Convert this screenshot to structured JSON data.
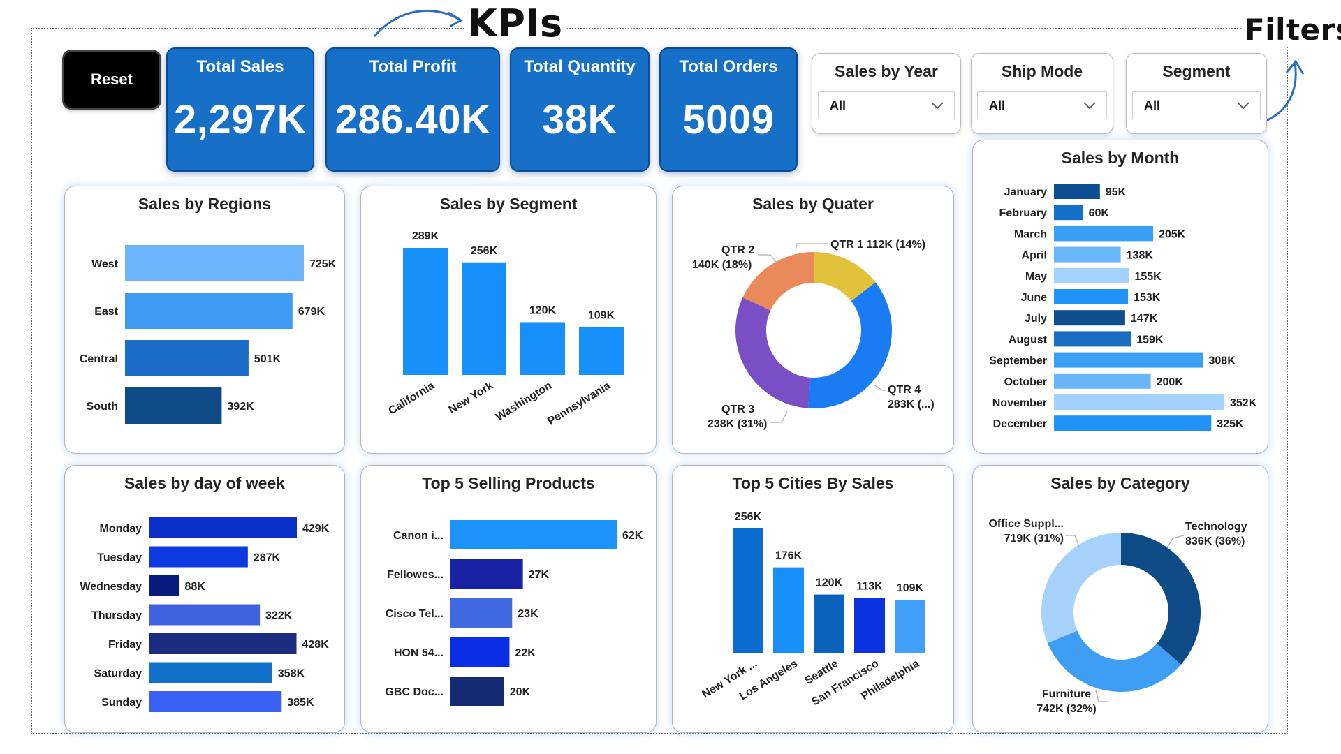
{
  "annotations": {
    "kpis": "KPIs",
    "filters": "Filters"
  },
  "reset_label": "Reset",
  "kpis": [
    {
      "title": "Total Sales",
      "value": "2,297K"
    },
    {
      "title": "Total Profit",
      "value": "286.40K"
    },
    {
      "title": "Total Quantity",
      "value": "38K"
    },
    {
      "title": "Total Orders",
      "value": "5009"
    }
  ],
  "filters": [
    {
      "title": "Sales by Year",
      "value": "All"
    },
    {
      "title": "Ship Mode",
      "value": "All"
    },
    {
      "title": "Segment",
      "value": "All"
    }
  ],
  "colors": {
    "kpi_bg": "#1670c8",
    "filter_border": "#bdbdbd",
    "card_glow": "#5a96e6"
  },
  "icons": [
    "chevron-down-icon",
    "curved-arrow-icon"
  ],
  "charts": {
    "regions": {
      "title": "Sales by Regions",
      "type": "bar-horizontal",
      "categories": [
        "West",
        "East",
        "Central",
        "South"
      ],
      "values": [
        725,
        679,
        501,
        392
      ],
      "labels": [
        "725K",
        "679K",
        "501K",
        "392K"
      ],
      "colors": [
        "#6cb4fb",
        "#3d9bf3",
        "#1a6cc6",
        "#0d4a87"
      ]
    },
    "segment": {
      "title": "Sales by Segment",
      "type": "bar",
      "categories": [
        "California",
        "New York",
        "Washington",
        "Pennsylvania"
      ],
      "values": [
        289,
        256,
        120,
        109
      ],
      "labels": [
        "289K",
        "256K",
        "120K",
        "109K"
      ],
      "color": "#1890fb"
    },
    "quarter": {
      "title": "Sales by Quater",
      "type": "donut",
      "slices": [
        {
          "name": "QTR 1",
          "value": 112,
          "label": "QTR 1 112K (14%)",
          "color": "#e2c13b"
        },
        {
          "name": "QTR 4",
          "value": 283,
          "label_lines": [
            "QTR 4",
            "283K (...)"
          ],
          "color": "#1a7cf2"
        },
        {
          "name": "QTR 3",
          "value": 238,
          "label_lines": [
            "QTR 3",
            "238K (31%)"
          ],
          "color": "#7a4fc6"
        },
        {
          "name": "QTR 2",
          "value": 140,
          "label_lines": [
            "QTR 2",
            "140K (18%)"
          ],
          "color": "#ea8a5b"
        }
      ]
    },
    "month": {
      "title": "Sales by Month",
      "type": "bar-horizontal",
      "categories": [
        "January",
        "February",
        "March",
        "April",
        "May",
        "June",
        "July",
        "August",
        "September",
        "October",
        "November",
        "December"
      ],
      "values": [
        95,
        60,
        205,
        138,
        155,
        153,
        147,
        159,
        308,
        200,
        352,
        325
      ],
      "labels": [
        "95K",
        "60K",
        "205K",
        "138K",
        "155K",
        "153K",
        "147K",
        "159K",
        "308K",
        "200K",
        "352K",
        "325K"
      ],
      "colors": [
        "#0d4f93",
        "#1570c8",
        "#3aa0f6",
        "#6ab6fa",
        "#a2d2fd",
        "#2192f8",
        "#0f4f8f",
        "#1a6dc1",
        "#3aa0f6",
        "#6ab6fa",
        "#a2d2fd",
        "#2192f8"
      ]
    },
    "weekday": {
      "title": "Sales by day of week",
      "type": "bar-horizontal",
      "categories": [
        "Monday",
        "Tuesday",
        "Wednesday",
        "Thursday",
        "Friday",
        "Saturday",
        "Sunday"
      ],
      "values": [
        429,
        287,
        88,
        322,
        428,
        358,
        385
      ],
      "labels": [
        "429K",
        "287K",
        "88K",
        "322K",
        "428K",
        "358K",
        "385K"
      ],
      "colors": [
        "#0b2fc9",
        "#0c39e0",
        "#081a7c",
        "#3f63e0",
        "#1b2c7f",
        "#1171c9",
        "#3b62f5"
      ]
    },
    "products": {
      "title": "Top 5 Selling Products",
      "type": "bar-horizontal",
      "categories": [
        "Canon i...",
        "Fellowes...",
        "Cisco Tel...",
        "HON 54...",
        "GBC Doc..."
      ],
      "values": [
        62,
        27,
        23,
        22,
        20
      ],
      "labels": [
        "62K",
        "27K",
        "23K",
        "22K",
        "20K"
      ],
      "colors": [
        "#1b93fb",
        "#1922a3",
        "#4169e1",
        "#0a2de6",
        "#162a74"
      ]
    },
    "cities": {
      "title": "Top 5 Cities By Sales",
      "type": "bar",
      "categories": [
        "New York ...",
        "Los Angeles",
        "Seattle",
        "San Francisco",
        "Philadelphia"
      ],
      "values": [
        256,
        176,
        120,
        113,
        109
      ],
      "labels": [
        "256K",
        "176K",
        "120K",
        "113K",
        "109K"
      ],
      "colors": [
        "#0a6dcf",
        "#1890fb",
        "#0a62bd",
        "#0a33df",
        "#3fa0fa"
      ]
    },
    "category": {
      "title": "Sales by Category",
      "type": "donut",
      "slices": [
        {
          "name": "Technology",
          "value": 836,
          "label_lines": [
            "Technology",
            "836K (36%)"
          ],
          "color": "#0d4a86"
        },
        {
          "name": "Furniture",
          "value": 742,
          "label_lines": [
            "Furniture",
            "742K (32%)"
          ],
          "color": "#3d9ef3"
        },
        {
          "name": "Office Suppl...",
          "value": 719,
          "label_lines": [
            "Office Suppl...",
            "719K (31%)"
          ],
          "color": "#a6d2fb"
        }
      ]
    }
  }
}
